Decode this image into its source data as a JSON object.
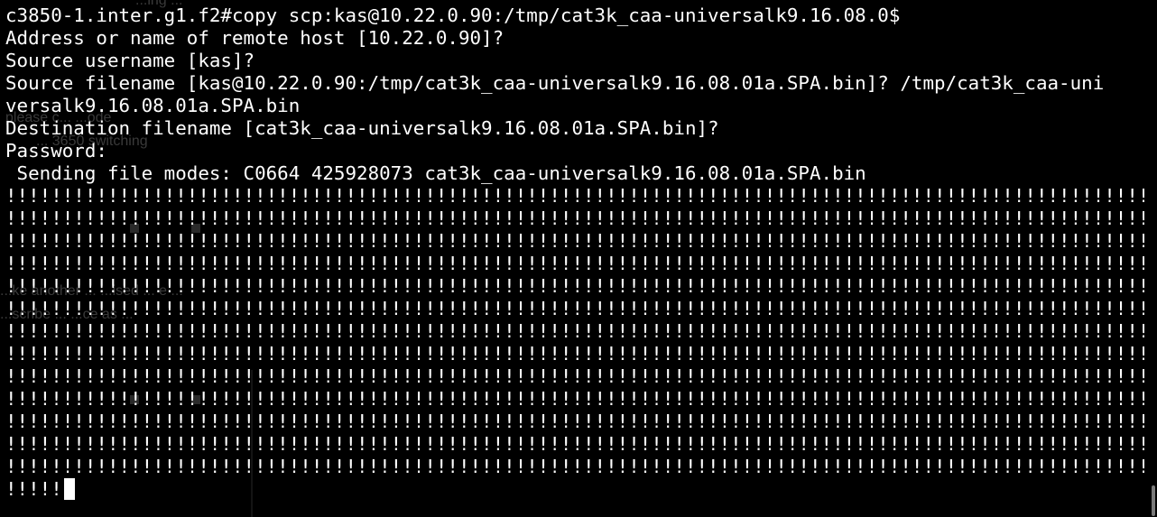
{
  "background": {
    "color": "#000000",
    "bleed_lines": [
      "...ing ...",
      "please c... ...ode",
      "... 3650 switching",
      "...ke another ... ...ised ... e ...",
      "...scribe ... ...ce as ..."
    ]
  },
  "terminal": {
    "text_color": "#ffffff",
    "lines": [
      "c3850-1.inter.g1.f2#copy scp:kas@10.22.0.90:/tmp/cat3k_caa-universalk9.16.08.0$",
      "Address or name of remote host [10.22.0.90]?",
      "Source username [kas]?",
      "Source filename [kas@10.22.0.90:/tmp/cat3k_caa-universalk9.16.08.01a.SPA.bin]? /tmp/cat3k_caa-uni",
      "versalk9.16.08.01a.SPA.bin",
      "Destination filename [cat3k_caa-universalk9.16.08.01a.SPA.bin]?",
      "Password:",
      " Sending file modes: C0664 425928073 cat3k_caa-universalk9.16.08.01a.SPA.bin",
      "!!!!!!!!!!!!!!!!!!!!!!!!!!!!!!!!!!!!!!!!!!!!!!!!!!!!!!!!!!!!!!!!!!!!!!!!!!!!!!!!!!!!!!!!!!!!!!!!!!!!!!",
      "!!!!!!!!!!!!!!!!!!!!!!!!!!!!!!!!!!!!!!!!!!!!!!!!!!!!!!!!!!!!!!!!!!!!!!!!!!!!!!!!!!!!!!!!!!!!!!!!!!!!!!",
      "!!!!!!!!!!!!!!!!!!!!!!!!!!!!!!!!!!!!!!!!!!!!!!!!!!!!!!!!!!!!!!!!!!!!!!!!!!!!!!!!!!!!!!!!!!!!!!!!!!!!!!",
      "!!!!!!!!!!!!!!!!!!!!!!!!!!!!!!!!!!!!!!!!!!!!!!!!!!!!!!!!!!!!!!!!!!!!!!!!!!!!!!!!!!!!!!!!!!!!!!!!!!!!!!",
      "!!!!!!!!!!!!!!!!!!!!!!!!!!!!!!!!!!!!!!!!!!!!!!!!!!!!!!!!!!!!!!!!!!!!!!!!!!!!!!!!!!!!!!!!!!!!!!!!!!!!!!",
      "!!!!!!!!!!!!!!!!!!!!!!!!!!!!!!!!!!!!!!!!!!!!!!!!!!!!!!!!!!!!!!!!!!!!!!!!!!!!!!!!!!!!!!!!!!!!!!!!!!!!!!",
      "!!!!!!!!!!!!!!!!!!!!!!!!!!!!!!!!!!!!!!!!!!!!!!!!!!!!!!!!!!!!!!!!!!!!!!!!!!!!!!!!!!!!!!!!!!!!!!!!!!!!!!",
      "!!!!!!!!!!!!!!!!!!!!!!!!!!!!!!!!!!!!!!!!!!!!!!!!!!!!!!!!!!!!!!!!!!!!!!!!!!!!!!!!!!!!!!!!!!!!!!!!!!!!!!",
      "!!!!!!!!!!!!!!!!!!!!!!!!!!!!!!!!!!!!!!!!!!!!!!!!!!!!!!!!!!!!!!!!!!!!!!!!!!!!!!!!!!!!!!!!!!!!!!!!!!!!!!",
      "!!!!!!!!!!!!!!!!!!!!!!!!!!!!!!!!!!!!!!!!!!!!!!!!!!!!!!!!!!!!!!!!!!!!!!!!!!!!!!!!!!!!!!!!!!!!!!!!!!!!!!",
      "!!!!!!!!!!!!!!!!!!!!!!!!!!!!!!!!!!!!!!!!!!!!!!!!!!!!!!!!!!!!!!!!!!!!!!!!!!!!!!!!!!!!!!!!!!!!!!!!!!!!!!",
      "!!!!!!!!!!!!!!!!!!!!!!!!!!!!!!!!!!!!!!!!!!!!!!!!!!!!!!!!!!!!!!!!!!!!!!!!!!!!!!!!!!!!!!!!!!!!!!!!!!!!!!",
      "!!!!!!!!!!!!!!!!!!!!!!!!!!!!!!!!!!!!!!!!!!!!!!!!!!!!!!!!!!!!!!!!!!!!!!!!!!!!!!!!!!!!!!!!!!!!!!!!!!!!!!",
      "!!!!!"
    ],
    "cursor_color": "#ffffff"
  },
  "scrollbar": {
    "thumb_color": "#7a7a7a"
  }
}
